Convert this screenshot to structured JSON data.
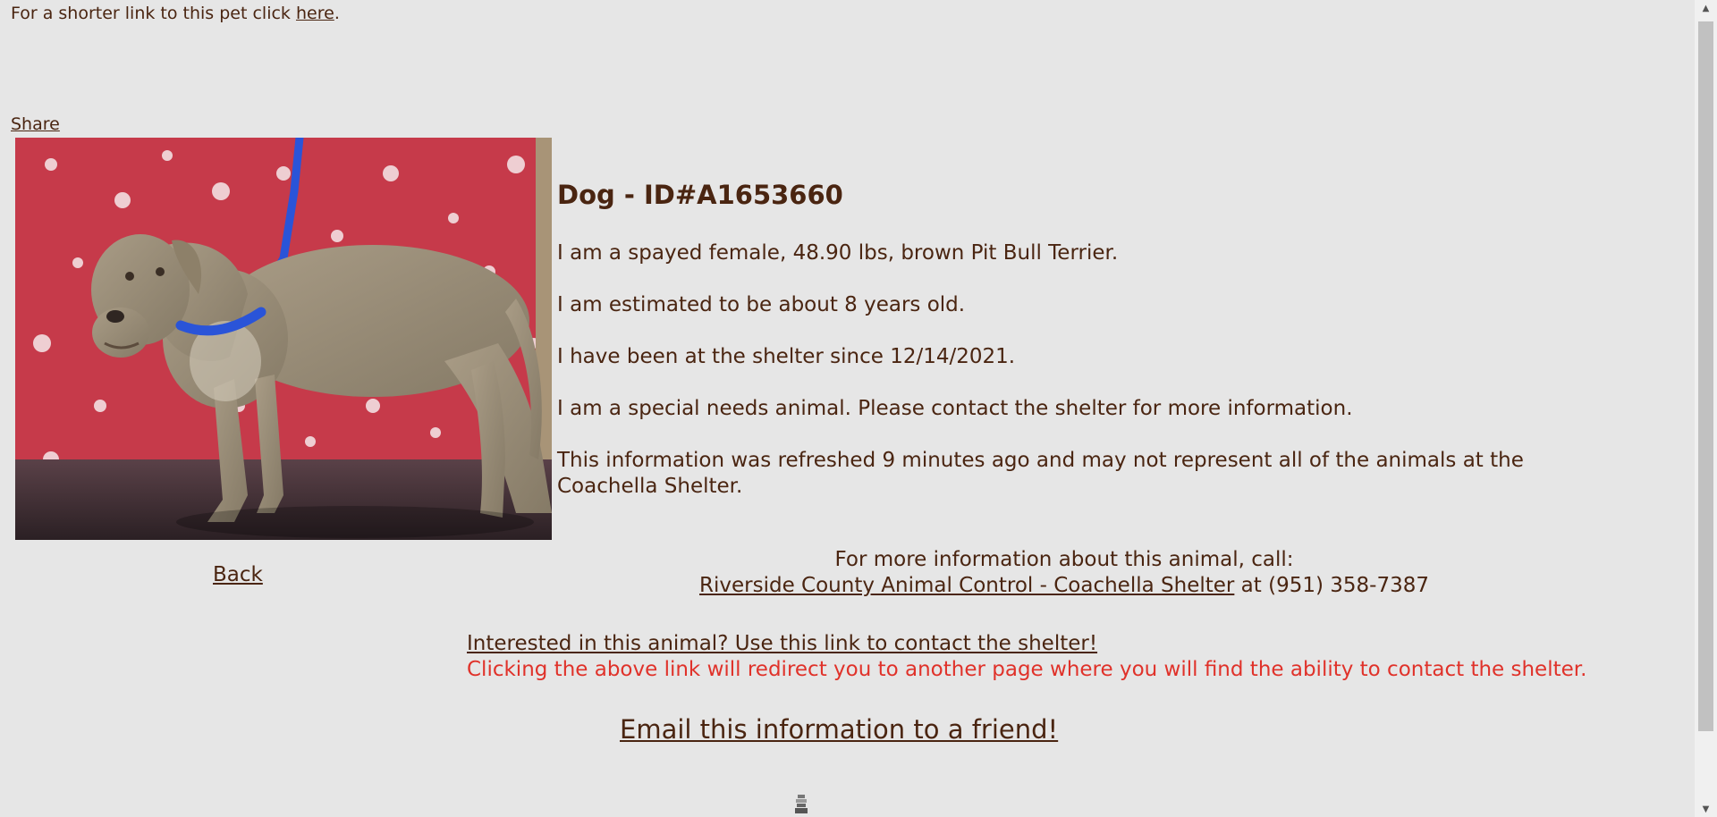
{
  "top": {
    "short_link_prefix": "For a shorter link to this pet click ",
    "short_link_text": "here",
    "short_link_suffix": ".",
    "share_label": "Share"
  },
  "animal": {
    "title": "Dog - ID#A1653660",
    "lines": [
      "I am a spayed female, 48.90 lbs, brown Pit Bull Terrier.",
      "I am estimated to be about 8 years old.",
      "I have been at the shelter since 12/14/2021.",
      "I am a special needs animal. Please contact the shelter for more information.",
      "This information was refreshed 9 minutes ago and may not represent all of the animals at the Coachella Shelter."
    ]
  },
  "nav": {
    "back_label": "Back"
  },
  "contact": {
    "call_prefix": "For more information about this animal, call:",
    "shelter_link": "Riverside County Animal Control - Coachella Shelter",
    "phone_text": " at (951) 358-7387",
    "interest_link": "Interested in this animal? Use this link to contact the shelter!",
    "redirect_note": "Clicking the above link will redirect you to another page where you will find the ability to contact the shelter.",
    "email_link": "Email this information to a friend!"
  },
  "colors": {
    "background": "#e6e6e6",
    "text": "#4a2511",
    "warning": "#e0322a"
  },
  "icons": {
    "loader": "loading-spinner-icon",
    "scroll_up": "scroll-up-arrow-icon",
    "scroll_down": "scroll-down-arrow-icon"
  }
}
